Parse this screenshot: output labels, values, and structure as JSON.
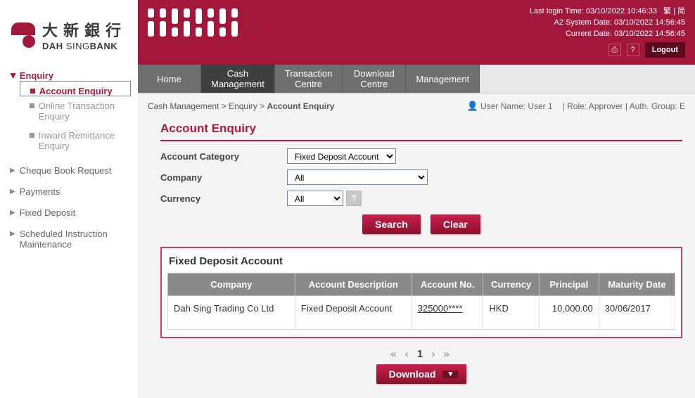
{
  "bank": {
    "name_cn": "大新銀行",
    "name_en_1": "DAH",
    "name_en_2": " SING",
    "name_en_3": "BANK"
  },
  "header": {
    "last_login": "Last login Time: 03/10/2022 10:46:33",
    "sys_date": "A2 System Date: 03/10/2022 14:56:45",
    "cur_date": "Current Date: 03/10/2022 14:56:45",
    "lang_trad": "繁",
    "lang_simp": "简",
    "help": "?",
    "logout": "Logout"
  },
  "topnav": {
    "home": "Home",
    "cash1": "Cash",
    "cash2": "Management",
    "txn1": "Transaction",
    "txn2": "Centre",
    "dl1": "Download",
    "dl2": "Centre",
    "mgmt": "Management"
  },
  "sidebar": {
    "enquiry": "Enquiry",
    "sub": {
      "acct": "Account Enquiry",
      "online": "Online Transaction Enquiry",
      "inward": "Inward Remittance Enquiry"
    },
    "cheque": "Cheque Book Request",
    "payments": "Payments",
    "fixed": "Fixed Deposit",
    "sched": "Scheduled Instruction Maintenance"
  },
  "crumb": {
    "a": "Cash Management",
    "b": "Enquiry",
    "c": "Account Enquiry",
    "sep": " > "
  },
  "userbar": {
    "uname_label": "User Name:",
    "uname": "User 1",
    "role": "| Role: Approver | Auth. Group: E"
  },
  "page": {
    "title": "Account Enquiry"
  },
  "filters": {
    "cat_label": "Account Category",
    "cat_value": "Fixed Deposit Account",
    "company_label": "Company",
    "company_value": "All",
    "currency_label": "Currency",
    "currency_value": "All"
  },
  "buttons": {
    "search": "Search",
    "clear": "Clear",
    "download": "Download"
  },
  "table": {
    "caption": "Fixed Deposit Account",
    "cols": {
      "company": "Company",
      "desc": "Account Description",
      "acct": "Account No.",
      "ccy": "Currency",
      "principal": "Principal",
      "maturity": "Maturity Date"
    },
    "rows": [
      {
        "company": "Dah Sing Trading Co Ltd",
        "desc": "Fixed Deposit Account",
        "acct": "325000****",
        "ccy": "HKD",
        "principal": "10,000.00",
        "maturity": "30/06/2017"
      }
    ]
  },
  "pager": {
    "first": "«",
    "prev": "‹",
    "page": "1",
    "next": "›",
    "last": "»"
  }
}
